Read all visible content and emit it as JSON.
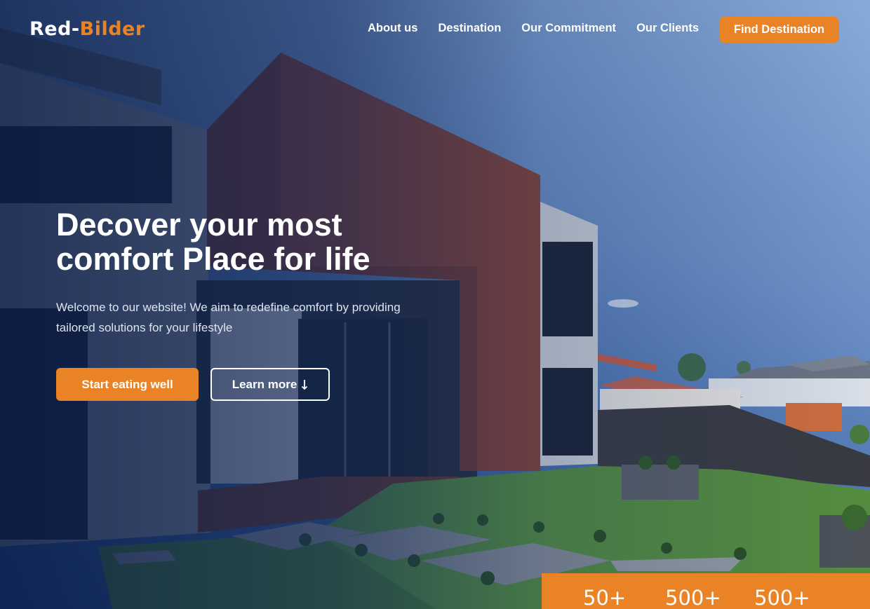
{
  "brand": {
    "name_part1": "Red-",
    "name_part2": "Bilder",
    "accent_color": "#ea8325"
  },
  "nav": {
    "links": [
      "About us",
      "Destination",
      "Our Commitment",
      "Our Clients"
    ],
    "cta_label": "Find Destination"
  },
  "hero": {
    "title_line1": "Decover your most",
    "title_line2": "comfort Place for life",
    "subtitle_line1": "Welcome to our website! We aim to redefine comfort by providing",
    "subtitle_line2": "tailored solutions for your lifestyle",
    "primary_button": "Start eating well",
    "secondary_button": "Learn more",
    "secondary_icon": "arrow-down-icon",
    "background_image": "modern house with red brick facade and lawn"
  },
  "stats": [
    "50+",
    "500+",
    "500+"
  ]
}
